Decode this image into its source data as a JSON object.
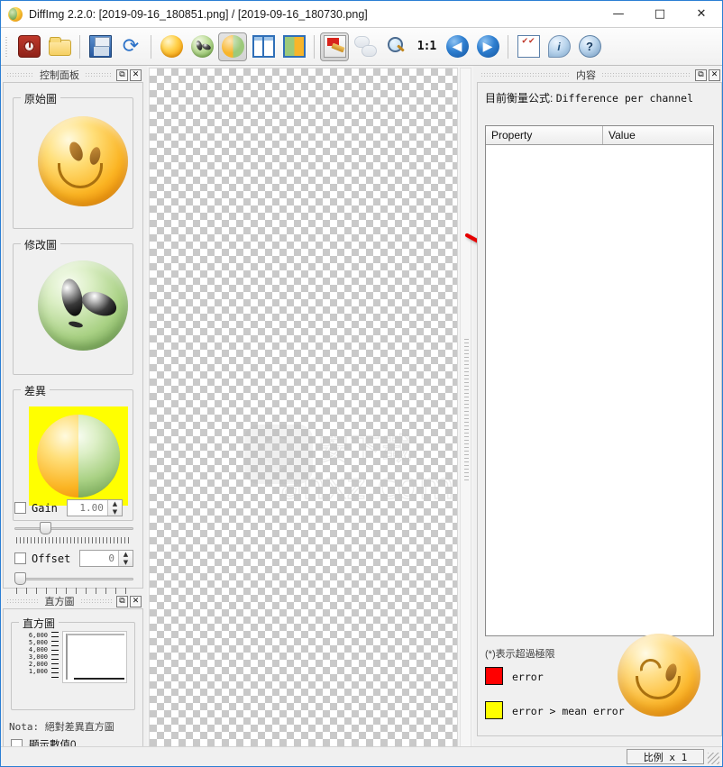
{
  "window": {
    "title": "DiffImg 2.2.0: [2019-09-16_180851.png] / [2019-09-16_180730.png]",
    "icon": "diffimg-app-icon",
    "minimize": "—",
    "maximize": "□",
    "close": "✕"
  },
  "toolbar": {
    "items": [
      {
        "name": "exit-button",
        "icon": "power-icon",
        "label": "Exit"
      },
      {
        "name": "open-button",
        "icon": "folder-open-icon",
        "label": "Open"
      },
      {
        "name": "save-button",
        "icon": "floppy-save-icon",
        "label": "Save"
      },
      {
        "name": "reload-button",
        "icon": "refresh-icon",
        "label": "Reload"
      },
      {
        "name": "show-original-button",
        "icon": "smiley-icon",
        "label": "Original image"
      },
      {
        "name": "show-modified-button",
        "icon": "alien-icon",
        "label": "Modified image"
      },
      {
        "name": "show-difference-button",
        "icon": "half-smiley-alien-icon",
        "label": "Difference"
      },
      {
        "name": "side-by-side-button",
        "icon": "split-view-icon",
        "label": "Side by side"
      },
      {
        "name": "blend-view-button",
        "icon": "blend-view-icon",
        "label": "Blend view"
      },
      {
        "name": "mask-tool-button",
        "icon": "paint-mask-icon",
        "label": "Mask"
      },
      {
        "name": "compare-button",
        "icon": "compare-bubbles-icon",
        "label": "Compare"
      },
      {
        "name": "zoom-fit-button",
        "icon": "zoom-fit-icon",
        "label": "Zoom fit"
      },
      {
        "name": "zoom-actual-button",
        "icon": "one-to-one-icon",
        "label": "1:1"
      },
      {
        "name": "previous-button",
        "icon": "arrow-left-icon",
        "label": "Previous"
      },
      {
        "name": "next-button",
        "icon": "arrow-right-icon",
        "label": "Next"
      },
      {
        "name": "options-button",
        "icon": "checklist-icon",
        "label": "Options"
      },
      {
        "name": "info-button",
        "icon": "info-icon",
        "label": "Info"
      },
      {
        "name": "help-button",
        "icon": "help-icon",
        "label": "Help"
      }
    ]
  },
  "left_panel": {
    "caption": "控制面板",
    "float_btn": "⧉",
    "close_btn": "✕",
    "groups": {
      "original": "原始圖",
      "modified": "修改圖",
      "difference": "差異"
    },
    "gain": {
      "label": "Gain",
      "value": "1.00",
      "checked": false
    },
    "offset": {
      "label": "Offset",
      "value": "0",
      "checked": false
    }
  },
  "histogram_panel": {
    "caption": "直方圖",
    "float_btn": "⧉",
    "close_btn": "✕",
    "group_title": "直方圖",
    "y_labels": [
      "6,000",
      "5,000",
      "4,000",
      "3,000",
      "2,000",
      "1,000"
    ],
    "note": "Nota: 絕對差異直方圖",
    "show_zero": {
      "label": "顯示數值0",
      "checked": false
    }
  },
  "canvas": {
    "name": "difference-canvas",
    "background": "transparency-checkerboard",
    "watermark": {
      "cn": "安下载",
      "en": "anxz.com"
    },
    "annotation_arrow": {
      "color": "#e60000",
      "from": [
        517,
        260
      ],
      "to": [
        640,
        328
      ]
    }
  },
  "right_panel": {
    "caption": "内容",
    "float_btn": "⧉",
    "close_btn": "✕",
    "formula_label": "目前衡量公式:",
    "formula_value": "Difference per channel",
    "table": {
      "columns": [
        "Property",
        "Value"
      ],
      "rows": []
    },
    "legend_note": "(*)表示超過極限",
    "legend": [
      {
        "color": "#ff0000",
        "label": "error"
      },
      {
        "color": "#ffff00",
        "label": "error > mean error"
      }
    ],
    "logo": "winking-smiley-logo"
  },
  "statusbar": {
    "scale_label": "比例 x  1"
  },
  "colors": {
    "accent": "#2b7fd4",
    "error_red": "#ff0000",
    "warn_yellow": "#ffff00",
    "panel_bg": "#f0f0f0"
  }
}
